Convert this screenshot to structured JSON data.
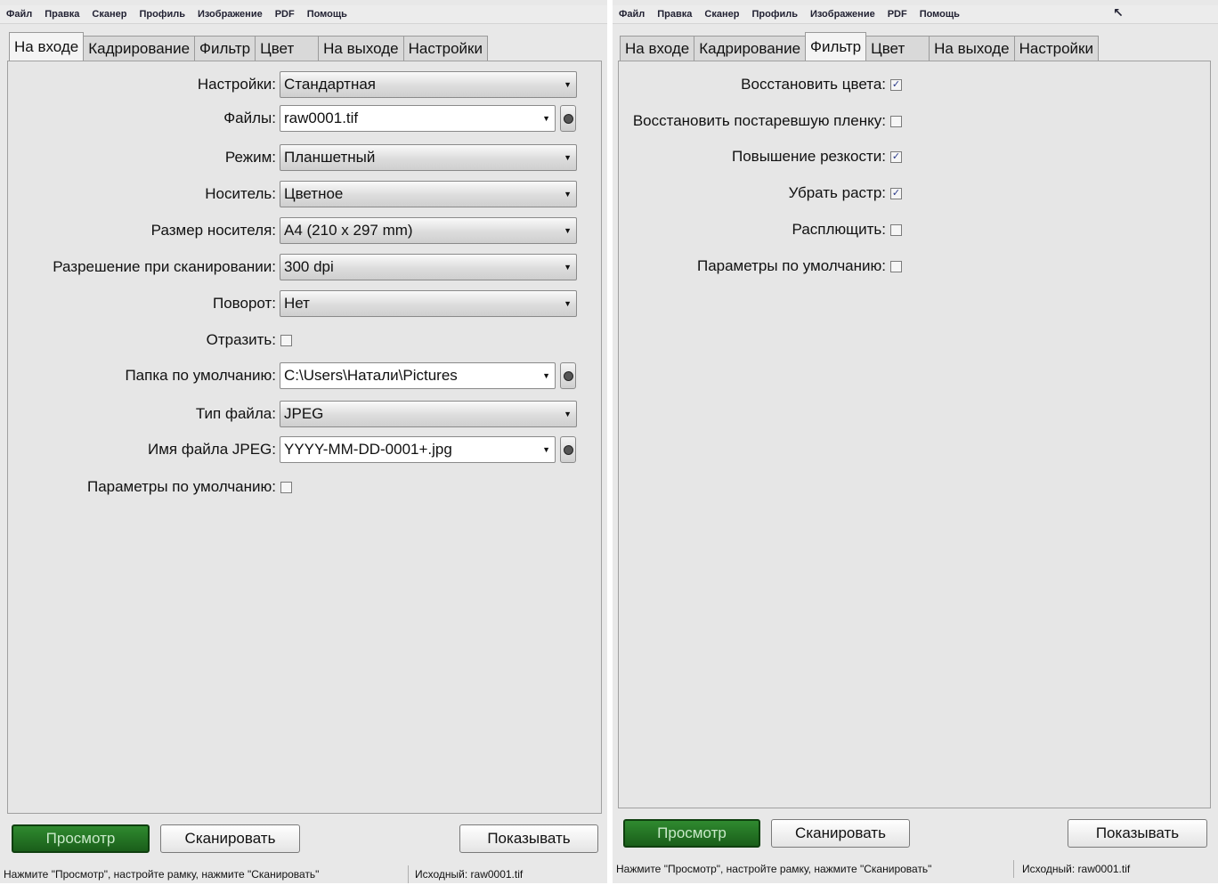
{
  "menu": [
    "Файл",
    "Правка",
    "Сканер",
    "Профиль",
    "Изображение",
    "PDF",
    "Помощь"
  ],
  "tabs": [
    "На входе",
    "Кадрирование",
    "Фильтр",
    "Цвет",
    "На выходе",
    "Настройки"
  ],
  "left": {
    "active_tab": "На входе",
    "fields": [
      {
        "label": "Настройки:",
        "value": "Стандартная"
      },
      {
        "label": "Файлы:",
        "value": "raw0001.tif"
      },
      {
        "label": "Режим:",
        "value": "Планшетный"
      },
      {
        "label": "Носитель:",
        "value": "Цветное"
      },
      {
        "label": "Размер носителя:",
        "value": "A4 (210 x 297 mm)"
      },
      {
        "label": "Разрешение при сканировании:",
        "value": "300 dpi"
      },
      {
        "label": "Поворот:",
        "value": "Нет"
      },
      {
        "label": "Отразить:",
        "checked": false
      },
      {
        "label": "Папка по умолчанию:",
        "value": "C:\\Users\\Натали\\Pictures"
      },
      {
        "label": "Тип файла:",
        "value": "JPEG"
      },
      {
        "label": "Имя файла JPEG:",
        "value": "YYYY-MM-DD-0001+.jpg"
      },
      {
        "label": "Параметры по умолчанию:",
        "checked": false
      }
    ]
  },
  "right": {
    "active_tab": "Фильтр",
    "checks": [
      {
        "label": "Восстановить цвета:",
        "checked": true
      },
      {
        "label": "Восстановить постаревшую пленку:",
        "checked": false
      },
      {
        "label": "Повышение резкости:",
        "checked": true
      },
      {
        "label": "Убрать растр:",
        "checked": true
      },
      {
        "label": "Расплющить:",
        "checked": false
      },
      {
        "label": "Параметры по умолчанию:",
        "checked": false
      }
    ]
  },
  "buttons": {
    "preview": "Просмотр",
    "scan": "Сканировать",
    "show": "Показывать"
  },
  "status": {
    "hint": "Нажмите \"Просмотр\", настройте рамку, нажмите \"Сканировать\"",
    "source": "Исходный: raw0001.tif"
  },
  "colors": {
    "preview_button": "#1f6e1f",
    "check_mark": "#2a3a8a"
  },
  "icons": {
    "dropdown": "chevron-down-icon",
    "browse": "browse-dot-icon"
  }
}
